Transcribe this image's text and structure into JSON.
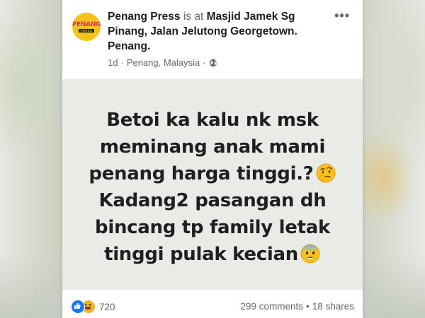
{
  "post": {
    "page_name": "Penang Press",
    "is_at": "is at",
    "location": "Masjid Jamek Sg Pinang, Jalan Jelutong Georgetown. Penang.",
    "time": "1d",
    "separator": "·",
    "place": "Penang, Malaysia",
    "privacy_icon": "globe-icon",
    "more_icon": "more-options-icon",
    "avatar_logo_text": "PENANG",
    "avatar_logo_sub": "PRESS",
    "image_text": {
      "line1": "Betoi ka kalu nk msk",
      "line2": "meminang anak mami",
      "line3": "penang harga tinggi.?",
      "line4": "Kadang2 pasangan dh",
      "line5": "bincang tp family letak",
      "line6": "tinggi pulak kecian"
    },
    "emoji_1": "thinking-face-icon",
    "emoji_2": "anxious-face-icon"
  },
  "footer": {
    "reaction_icons": [
      "like-icon",
      "haha-icon"
    ],
    "reaction_count": "720",
    "comments": "299 comments",
    "dot": "•",
    "shares": "18 shares"
  },
  "colors": {
    "facebook_blue": "#1877f2",
    "haha_yellow": "#f7b125",
    "text_primary": "#1c1e21",
    "text_secondary": "#65676b"
  }
}
